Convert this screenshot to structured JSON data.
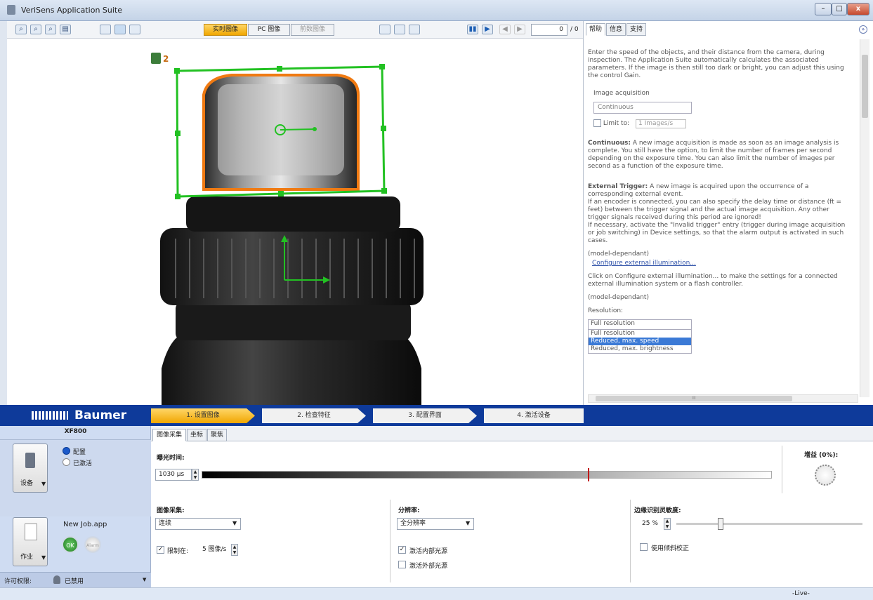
{
  "app": {
    "title": "VeriSens Application Suite"
  },
  "window": {
    "minimize": "–",
    "maximize": "□",
    "close": "x"
  },
  "toolbar": {
    "zoom_out_icon": "⌕",
    "zoom_in_icon": "⌕",
    "zoom_fit_icon": "⌕",
    "save_icon": "▤",
    "mode_live": "实时图像",
    "mode_pc": "PC 图像",
    "mode_saved": "前数图像",
    "frame_value": "0",
    "frame_total": "/ 0"
  },
  "help": {
    "tabs": [
      "帮助",
      "信息",
      "支持"
    ],
    "intro": "Enter the speed of the objects, and their distance from the camera, during inspection. The Application Suite automatically calculates the associated parameters. If the image is then still too dark or bright, you can adjust this using the control Gain.",
    "image_acq_label": "Image acquisition",
    "image_acq_value": "Continuous",
    "limit_label": "Limit to:",
    "limit_value": "1 Images/s",
    "continuous_title": "Continuous:",
    "continuous_text": "A new image acquisition is made as soon as an image analysis is complete. You still have the option, to limit the number of frames per second depending on the exposure time. You can also limit the number of images per second as a function of the exposure time.",
    "ext_title": "External Trigger:",
    "ext_text1": "A new image is acquired upon the occurrence of a corresponding external event.",
    "ext_text2": "If an encoder is connected, you can also specify the delay time or distance (ft = feet) between the trigger signal and the actual image acquisition. Any other trigger signals received during this period are ignored!",
    "ext_text3": "If necessary, activate the \"Invalid trigger\" entry (trigger during image acquisition or job switching) in Device settings, so that the alarm output is activated in such cases.",
    "model_dep1": "(model-dependant)",
    "config_link": "Configure external illumination...",
    "config_text": "Click on Configure external illumination... to make the settings for a connected external illumination system or a flash controller.",
    "model_dep2": "(model-dependant)",
    "resolution_label": "Resolution:",
    "resolution_value": "Full resolution",
    "resolution_options": [
      "Full resolution",
      "Reduced, max. speed",
      "Reduced, max. brightness"
    ],
    "scroll_mark": "III"
  },
  "brand": "Baumer",
  "steps": [
    "1. 设置图像",
    "2. 检查特征",
    "3. 配置界面",
    "4. 激活设备"
  ],
  "left": {
    "device_name": "XF800",
    "radio_config": "配置",
    "radio_active": "已激活",
    "device_btn": "设备",
    "job_name": "New Job.app",
    "job_btn": "作业",
    "ok": "OK",
    "alarm": "Alarm",
    "license_label": "许可权限:",
    "license_value": "已禁用"
  },
  "main": {
    "subtabs": [
      "图像采集",
      "坐标",
      "聚焦"
    ],
    "exposure_label": "曝光时间:",
    "exposure_value": "1030 μs",
    "gain_label": "增益 (0%):",
    "acq_label": "图像采集:",
    "acq_value": "连续",
    "limit_label": "限制在:",
    "limit_value": "5 图像/s",
    "res_label": "分辨率:",
    "res_value": "全分辨率",
    "internal_light": "激活内部光源",
    "external_light": "激活外部光源",
    "edge_label": "边缘识别灵敏度:",
    "edge_value": "25 %",
    "edge_level": 0.25,
    "tilt_label": "使用倾斜校正"
  },
  "status": {
    "live": "-Live-"
  },
  "overlay": {
    "roi_label": "2"
  }
}
